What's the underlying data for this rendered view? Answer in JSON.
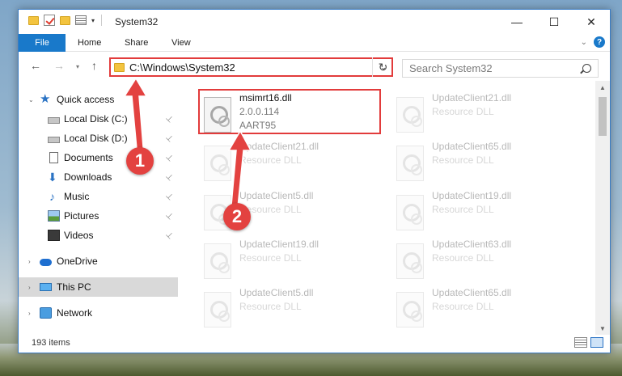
{
  "window": {
    "title": "System32",
    "minimize": "—",
    "maximize": "☐",
    "close": "✕"
  },
  "ribbon": {
    "tabs": [
      "File",
      "Home",
      "Share",
      "View"
    ],
    "expand_glyph": "⌄",
    "help": "?"
  },
  "navigation": {
    "back": "←",
    "forward": "→",
    "recent": "▾",
    "up": "↑",
    "address": "C:\\Windows\\System32",
    "address_dropdown": "⌄",
    "refresh": "↻",
    "search_placeholder": "Search System32"
  },
  "sidebar": {
    "items": [
      {
        "label": "Quick access",
        "icon": "star-icon",
        "glyph": "★"
      },
      {
        "label": "Local Disk (C:)",
        "icon": "drive-icon",
        "glyph": ""
      },
      {
        "label": "Local Disk (D:)",
        "icon": "drive-icon",
        "glyph": ""
      },
      {
        "label": "Documents",
        "icon": "documents-icon",
        "glyph": ""
      },
      {
        "label": "Downloads",
        "icon": "download-icon",
        "glyph": "⬇"
      },
      {
        "label": "Music",
        "icon": "music-icon",
        "glyph": "♪"
      },
      {
        "label": "Pictures",
        "icon": "pictures-icon",
        "glyph": ""
      },
      {
        "label": "Videos",
        "icon": "videos-icon",
        "glyph": ""
      },
      {
        "label": "OneDrive",
        "icon": "cloud-icon",
        "glyph": ""
      },
      {
        "label": "This PC",
        "icon": "computer-icon",
        "glyph": ""
      },
      {
        "label": "Network",
        "icon": "network-icon",
        "glyph": ""
      }
    ],
    "pin_glyph": "📌",
    "chevron": "›"
  },
  "files": [
    {
      "name": "msimrt16.dll",
      "version": "2.0.0.114",
      "company": "AART95"
    },
    {
      "name": "UpdateClient21.dll",
      "type": "Resource DLL"
    },
    {
      "name": "UpdateClient21.dll",
      "type": "Resource DLL"
    },
    {
      "name": "UpdateClient65.dll",
      "type": "Resource DLL"
    },
    {
      "name": "UpdateClient5.dll",
      "type": "Resource DLL"
    },
    {
      "name": "UpdateClient19.dll",
      "type": "Resource DLL"
    },
    {
      "name": "UpdateClient19.dll",
      "type": "Resource DLL"
    },
    {
      "name": "UpdateClient63.dll",
      "type": "Resource DLL"
    },
    {
      "name": "UpdateClient5.dll",
      "type": "Resource DLL"
    },
    {
      "name": "UpdateClient65.dll",
      "type": "Resource DLL"
    }
  ],
  "status": {
    "item_count": "193 items"
  },
  "annotations": {
    "step1": "1",
    "step2": "2"
  },
  "colors": {
    "accent": "#1979ca",
    "highlight": "#e23b3b"
  }
}
